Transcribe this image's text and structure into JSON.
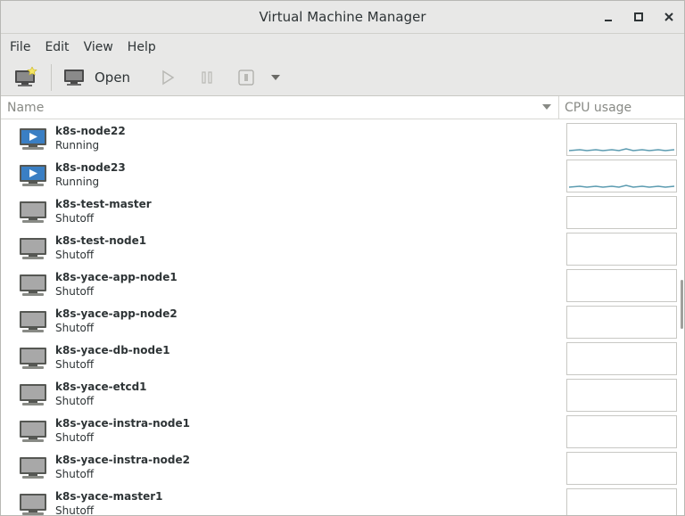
{
  "window": {
    "title": "Virtual Machine Manager"
  },
  "menu": [
    "File",
    "Edit",
    "View",
    "Help"
  ],
  "toolbar": {
    "open_label": "Open"
  },
  "columns": {
    "name": "Name",
    "cpu": "CPU usage"
  },
  "vms": [
    {
      "name": "k8s-node22",
      "status": "Running",
      "state": "running"
    },
    {
      "name": "k8s-node23",
      "status": "Running",
      "state": "running"
    },
    {
      "name": "k8s-test-master",
      "status": "Shutoff",
      "state": "shutoff"
    },
    {
      "name": "k8s-test-node1",
      "status": "Shutoff",
      "state": "shutoff"
    },
    {
      "name": "k8s-yace-app-node1",
      "status": "Shutoff",
      "state": "shutoff"
    },
    {
      "name": "k8s-yace-app-node2",
      "status": "Shutoff",
      "state": "shutoff"
    },
    {
      "name": "k8s-yace-db-node1",
      "status": "Shutoff",
      "state": "shutoff"
    },
    {
      "name": "k8s-yace-etcd1",
      "status": "Shutoff",
      "state": "shutoff"
    },
    {
      "name": "k8s-yace-instra-node1",
      "status": "Shutoff",
      "state": "shutoff"
    },
    {
      "name": "k8s-yace-instra-node2",
      "status": "Shutoff",
      "state": "shutoff"
    },
    {
      "name": "k8s-yace-master1",
      "status": "Shutoff",
      "state": "shutoff"
    }
  ],
  "colors": {
    "running_screen": "#3a7fc4",
    "shutoff_screen": "#a8a8a8",
    "cpu_line": "#5b9bb0"
  },
  "icons": [
    "new-vm-icon",
    "monitor-icon",
    "play-icon",
    "pause-icon",
    "shutdown-icon",
    "dropdown-arrow-icon",
    "minimize-icon",
    "maximize-icon",
    "close-icon"
  ]
}
